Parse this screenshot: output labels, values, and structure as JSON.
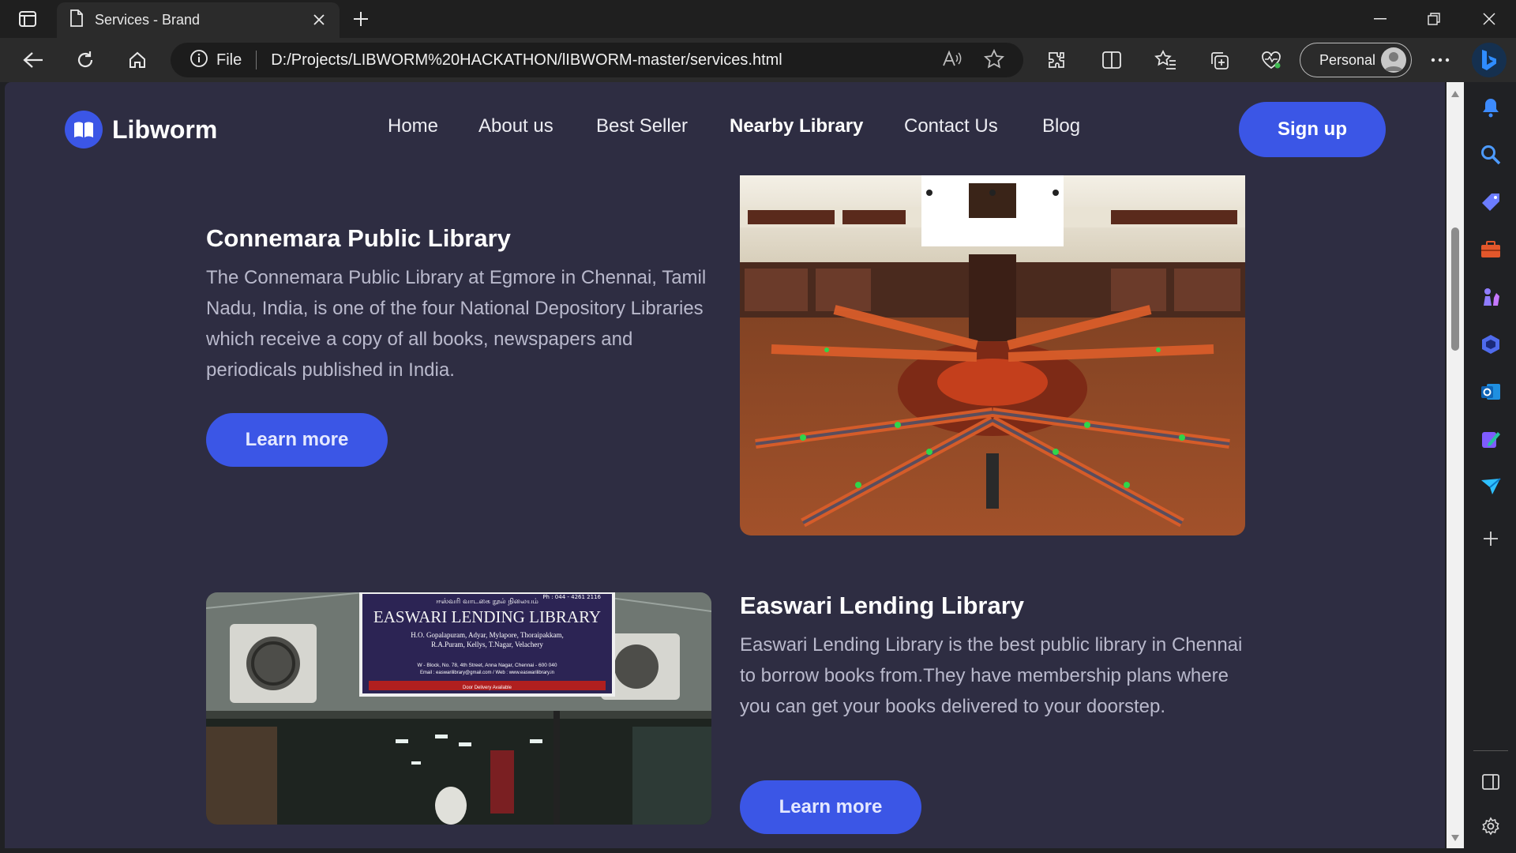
{
  "browser": {
    "tab_title": "Services - Brand",
    "address_prefix": "File",
    "url": "D:/Projects/LIBWORM%20HACKATHON/lIBWORM-master/services.html",
    "profile_label": "Personal"
  },
  "site": {
    "brand": "Libworm",
    "nav": [
      {
        "label": "Home"
      },
      {
        "label": "About us"
      },
      {
        "label": "Best Seller"
      },
      {
        "label": "Nearby Library"
      },
      {
        "label": "Contact Us"
      },
      {
        "label": "Blog"
      }
    ],
    "active_nav": "Nearby Library",
    "signup_label": "Sign up",
    "accent_color": "#3b56e6",
    "background_color": "#2e2d42"
  },
  "libraries": [
    {
      "name": "Connemara Public Library",
      "description": "The Connemara Public Library at Egmore in Chennai, Tamil Nadu, India, is one of the four National Depository Libraries which receive a copy of all books, newspapers and periodicals published in India.",
      "button": "Learn more"
    },
    {
      "name": "Easwari Lending Library",
      "description": "Easwari Lending Library is the best public library in Chennai to borrow books from.They have membership plans where you can get your books delivered to your doorstep.",
      "button": "Learn more",
      "sign": {
        "tamil": "ஈஸ்வரி வாடகை நூல் நிலையம்",
        "phone": "Ph : 044 - 4261 2116",
        "title": "EASWARI LENDING LIBRARY",
        "branches_1": "H.O. Gopalapuram, Adyar, Mylapore, Thoraipakkam,",
        "branches_2": "R.A.Puram, Kellys, T.Nagar, Velachery",
        "address": "W - Block, No. 78, 4th Street, Anna Nagar, Chennai - 600 040",
        "contact": "Email : easwarilibrary@gmail.com / Web : www.easwarilibrary.in",
        "delivery": "Door Delivery Available"
      }
    }
  ]
}
